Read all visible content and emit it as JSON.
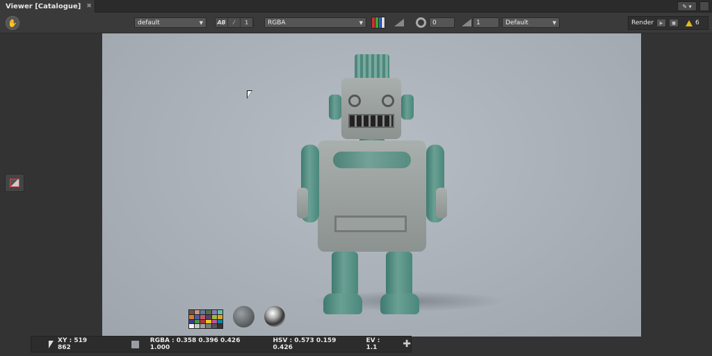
{
  "tab": {
    "title": "Viewer [Catalogue]",
    "close_glyph": "✖"
  },
  "tab_tools": {
    "pin_glyph": "✎ ▾"
  },
  "toolbar": {
    "display_select": "default",
    "ab_label": "AB",
    "wipe_glyph": "⁄",
    "one_label": "1",
    "channel_select": "RGBA",
    "aperture_value": "0",
    "gamma_value": "1",
    "lut_select": "Default"
  },
  "render": {
    "label": "Render",
    "warnings": "6"
  },
  "status": {
    "xy": "XY : 519 862",
    "rgba": "RGBA : 0.358 0.396 0.426 1.000",
    "hsv": "HSV : 0.573 0.159 0.426",
    "ev": "EV : 1.1"
  },
  "colors": {
    "accent_warning": "#e8b820",
    "robot_teal": "#5a9488",
    "robot_silver": "#9aa09e",
    "background": "#aab1b9"
  }
}
